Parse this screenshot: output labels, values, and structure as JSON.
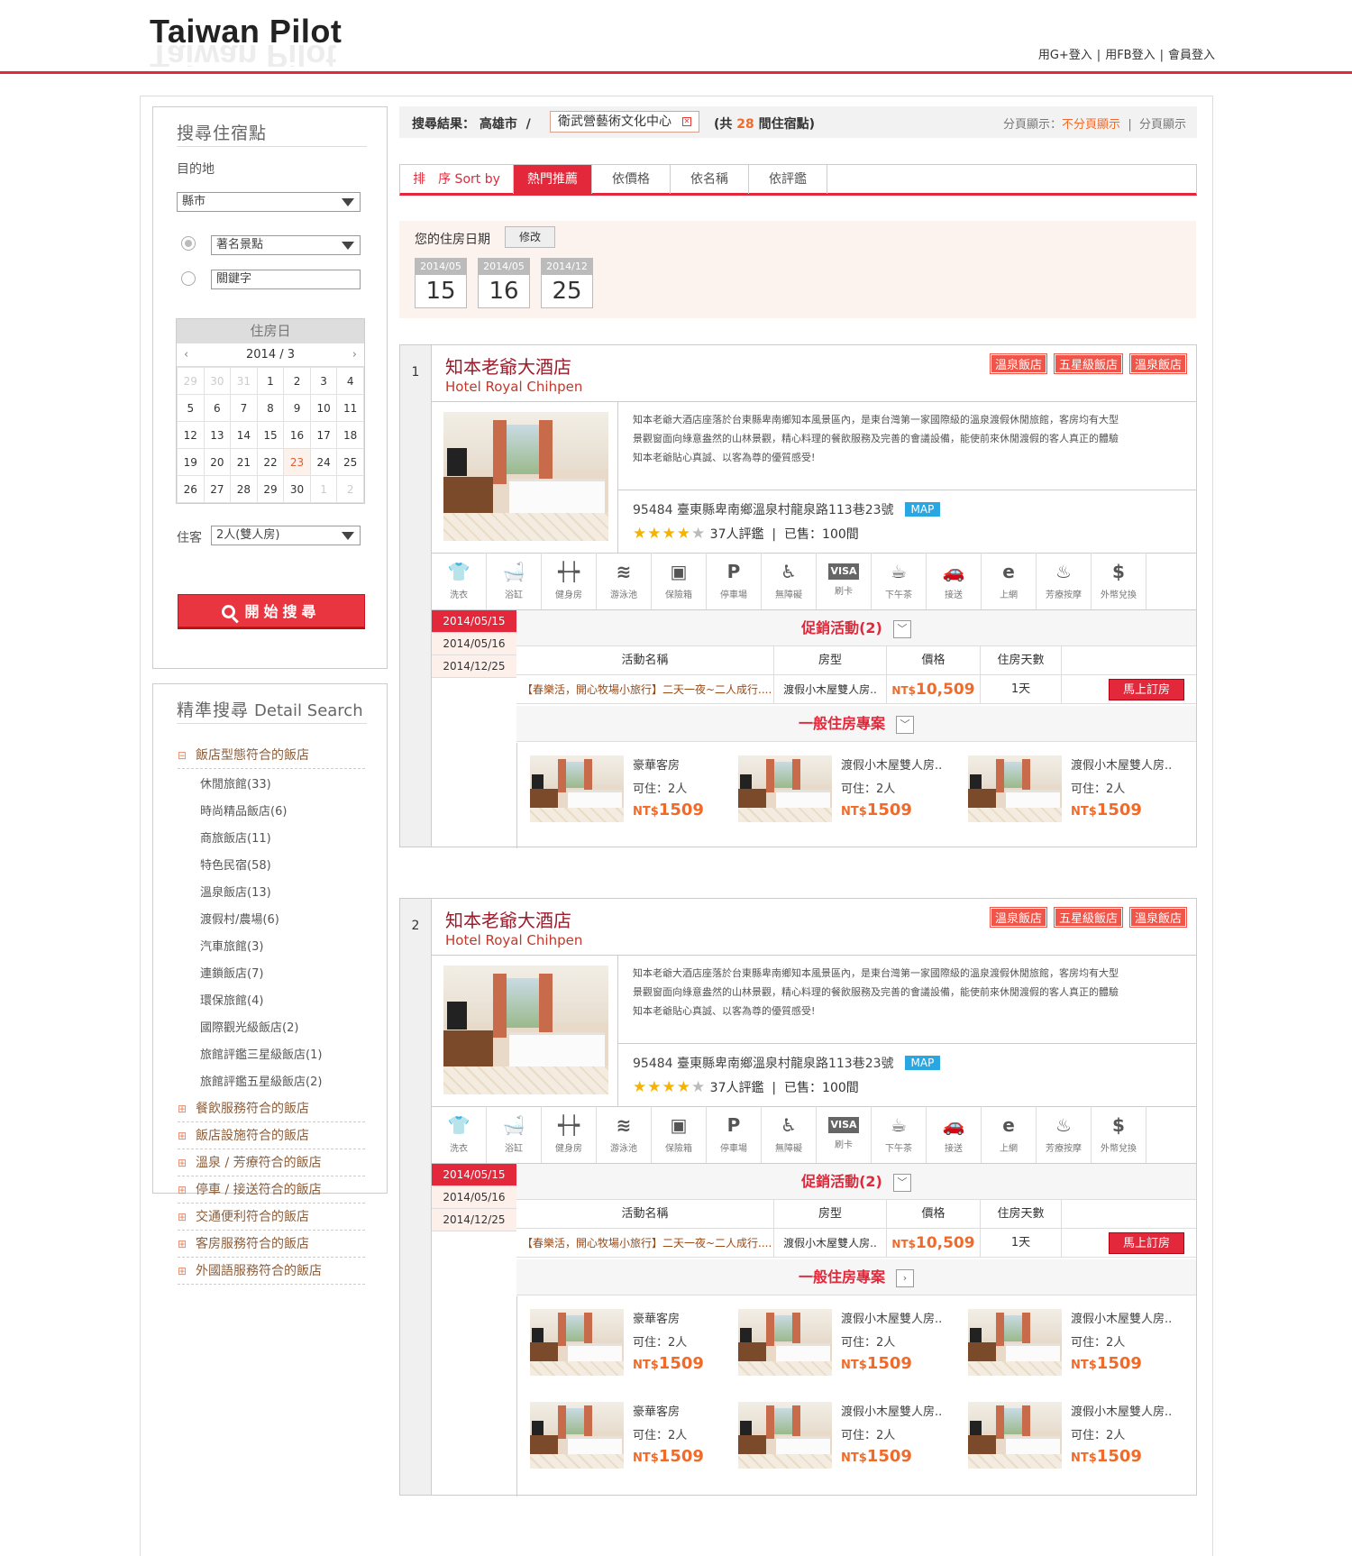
{
  "header": {
    "logo": "Taiwan Pilot",
    "links": [
      "用G+登入",
      "用FB登入",
      "會員登入"
    ]
  },
  "search": {
    "title": "搜尋住宿點",
    "dest_label": "目的地",
    "county_select": "縣市",
    "spot_select": "著名景點",
    "keyword_placeholder": "關鍵字",
    "calendar": {
      "title": "住房日",
      "month": "2014 / 3",
      "prev": "‹",
      "next": "›",
      "weeks": [
        [
          "29",
          "30",
          "31",
          "1",
          "2",
          "3",
          "4"
        ],
        [
          "5",
          "6",
          "7",
          "8",
          "9",
          "10",
          "11"
        ],
        [
          "12",
          "13",
          "14",
          "15",
          "16",
          "17",
          "18"
        ],
        [
          "19",
          "20",
          "21",
          "22",
          "23",
          "24",
          "25"
        ],
        [
          "26",
          "27",
          "28",
          "29",
          "30",
          "1",
          "2"
        ]
      ]
    },
    "guest_label": "住客",
    "guest_select": "2人(雙人房)",
    "button": "開始搜尋"
  },
  "detail": {
    "title": "精準搜尋",
    "title_en": "Detail Search",
    "open_section": "飯店型態符合的飯店",
    "items": [
      "休閒旅館(33)",
      "時尚精品飯店(6)",
      "商旅飯店(11)",
      "特色民宿(58)",
      "溫泉飯店(13)",
      "渡假村/農場(6)",
      "汽車旅館(3)",
      "連鎖飯店(7)",
      "環保旅館(4)",
      "國際觀光級飯店(2)",
      "旅館評鑑三星級飯店(1)",
      "旅館評鑑五星級飯店(2)"
    ],
    "sections": [
      "餐飲服務符合的飯店",
      "飯店設施符合的飯店",
      "溫泉 / 芳療符合的飯店",
      "停車 / 接送符合的飯店",
      "交通便利符合的飯店",
      "客房服務符合的飯店",
      "外國語服務符合的飯店"
    ]
  },
  "results": {
    "label": "搜尋結果：",
    "city": "高雄市",
    "slash": "/",
    "location": "衛武營藝術文化中心",
    "count_pre": "(共",
    "count": "28",
    "count_post": "間住宿點)",
    "paging_label": "分頁顯示：",
    "paging_on": "不分頁顯示",
    "paging_off": "分頁顯示"
  },
  "sort": {
    "label": "排　序 Sort by",
    "options": [
      "熱門推薦",
      "依價格",
      "依名稱",
      "依評鑑"
    ]
  },
  "dates": {
    "label": "您的住房日期",
    "modify": "修改",
    "cards": [
      {
        "month": "2014/05",
        "day": "15"
      },
      {
        "month": "2014/05",
        "day": "16"
      },
      {
        "month": "2014/12",
        "day": "25"
      }
    ]
  },
  "hotels": [
    {
      "num": "1",
      "name": "知本老爺大酒店",
      "ename": "Hotel Royal Chihpen",
      "tags": [
        "溫泉飯店",
        "五星級飯店",
        "溫泉飯店"
      ],
      "desc": "知本老爺大酒店座落於台東縣卑南鄉知本風景區內，是東台灣第一家國際級的溫泉渡假休閒旅館，客房均有大型景觀窗面向綠意盎然的山林景觀，精心料理的餐飲服務及完善的會議設備，能使前來休閒渡假的客人真正的體驗知本老爺貼心真誠、以客為尊的優質感受!",
      "address": "95484 臺東縣卑南鄉溫泉村龍泉路113巷23號",
      "map": "MAP",
      "stars": 4,
      "reviews": "37人評鑑",
      "sold": "已售：100間",
      "promo_dates": [
        "2014/05/15",
        "2014/05/16",
        "2014/12/25"
      ],
      "promo_title": "促銷活動(2)",
      "promo_headers": [
        "活動名稱",
        "房型",
        "價格",
        "住房天數"
      ],
      "promo_row": {
        "name": "【春樂活，開心牧場小旅行】二天一夜~二人成行....",
        "room": "渡假小木屋雙人房..",
        "currency": "NT$",
        "price": "10,509",
        "days": "1天",
        "book": "馬上訂房"
      },
      "plan_title": "一般住房專案",
      "rooms": [
        {
          "title": "豪華客房",
          "cap": "可住：2人",
          "currency": "NT$",
          "price": "1509"
        },
        {
          "title": "渡假小木屋雙人房..",
          "cap": "可住：2人",
          "currency": "NT$",
          "price": "1509"
        },
        {
          "title": "渡假小木屋雙人房..",
          "cap": "可住：2人",
          "currency": "NT$",
          "price": "1509"
        }
      ]
    },
    {
      "num": "2",
      "name": "知本老爺大酒店",
      "ename": "Hotel Royal Chihpen",
      "tags": [
        "溫泉飯店",
        "五星級飯店",
        "溫泉飯店"
      ],
      "desc": "知本老爺大酒店座落於台東縣卑南鄉知本風景區內，是東台灣第一家國際級的溫泉渡假休閒旅館，客房均有大型景觀窗面向綠意盎然的山林景觀，精心料理的餐飲服務及完善的會議設備，能使前來休閒渡假的客人真正的體驗知本老爺貼心真誠、以客為尊的優質感受!",
      "address": "95484 臺東縣卑南鄉溫泉村龍泉路113巷23號",
      "map": "MAP",
      "stars": 4,
      "reviews": "37人評鑑",
      "sold": "已售：100間",
      "promo_dates": [
        "2014/05/15",
        "2014/05/16",
        "2014/12/25"
      ],
      "promo_title": "促銷活動(2)",
      "promo_headers": [
        "活動名稱",
        "房型",
        "價格",
        "住房天數"
      ],
      "promo_row": {
        "name": "【春樂活，開心牧場小旅行】二天一夜~二人成行....",
        "room": "渡假小木屋雙人房..",
        "currency": "NT$",
        "price": "10,509",
        "days": "1天",
        "book": "馬上訂房"
      },
      "plan_title": "一般住房專案",
      "rooms": [
        {
          "title": "豪華客房",
          "cap": "可住：2人",
          "currency": "NT$",
          "price": "1509"
        },
        {
          "title": "渡假小木屋雙人房..",
          "cap": "可住：2人",
          "currency": "NT$",
          "price": "1509"
        },
        {
          "title": "渡假小木屋雙人房..",
          "cap": "可住：2人",
          "currency": "NT$",
          "price": "1509"
        },
        {
          "title": "豪華客房",
          "cap": "可住：2人",
          "currency": "NT$",
          "price": "1509"
        },
        {
          "title": "渡假小木屋雙人房..",
          "cap": "可住：2人",
          "currency": "NT$",
          "price": "1509"
        },
        {
          "title": "渡假小木屋雙人房..",
          "cap": "可住：2人",
          "currency": "NT$",
          "price": "1509"
        }
      ]
    }
  ],
  "facilities": [
    {
      "label": "洗衣",
      "icon": "laundry-icon",
      "glyph": "👕"
    },
    {
      "label": "浴缸",
      "icon": "bathtub-icon",
      "glyph": "🛁"
    },
    {
      "label": "健身房",
      "icon": "gym-icon",
      "glyph": "┽┾"
    },
    {
      "label": "游泳池",
      "icon": "pool-icon",
      "glyph": "≋"
    },
    {
      "label": "保險箱",
      "icon": "safe-icon",
      "glyph": "▣"
    },
    {
      "label": "停車場",
      "icon": "parking-icon",
      "glyph": "P"
    },
    {
      "label": "無障礙",
      "icon": "accessible-icon",
      "glyph": "♿"
    },
    {
      "label": "刷卡",
      "icon": "credit-card-icon",
      "glyph": "VISA"
    },
    {
      "label": "下午茶",
      "icon": "tea-icon",
      "glyph": "☕"
    },
    {
      "label": "接送",
      "icon": "shuttle-icon",
      "glyph": "🚗"
    },
    {
      "label": "上網",
      "icon": "internet-icon",
      "glyph": "e"
    },
    {
      "label": "芳療按摩",
      "icon": "massage-icon",
      "glyph": "♨"
    },
    {
      "label": "外幣兌換",
      "icon": "currency-exchange-icon",
      "glyph": "$"
    }
  ],
  "colors": {
    "accent": "#e2283a",
    "price": "#f06a2a",
    "tag": "#f0554a",
    "map": "#2aa6e0"
  }
}
